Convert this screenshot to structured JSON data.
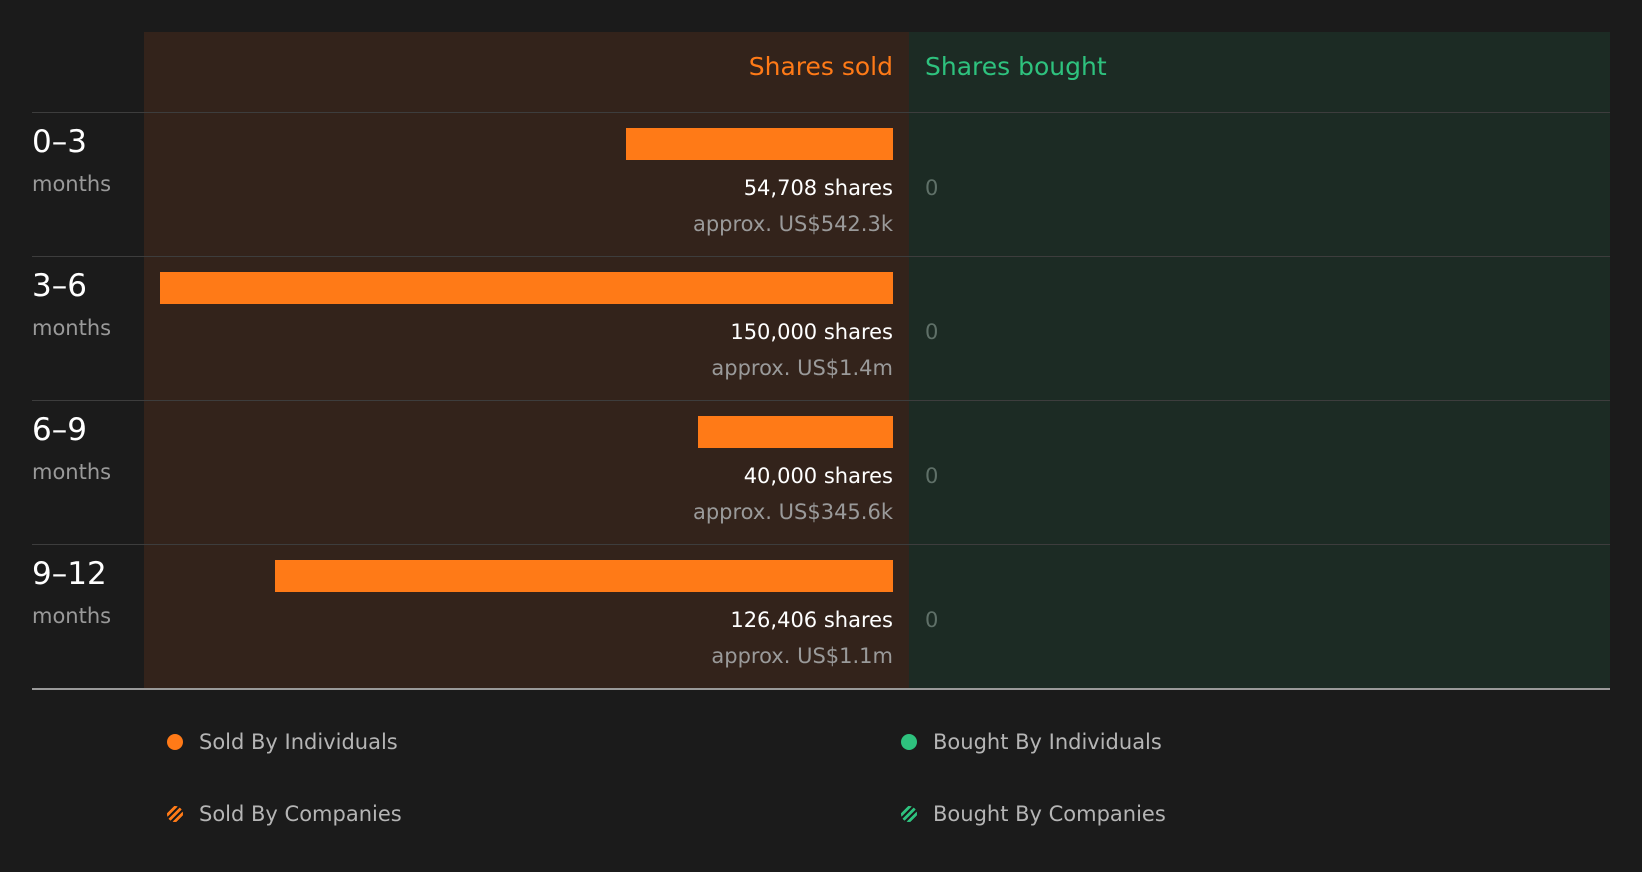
{
  "colors": {
    "sold": "#ff7a17",
    "bought": "#2ec27e"
  },
  "header": {
    "sold_label": "Shares sold",
    "bought_label": "Shares bought"
  },
  "chart_data": {
    "type": "bar",
    "orientation": "horizontal-diverging",
    "categories": [
      "0–3 months",
      "3–6 months",
      "6–9 months",
      "9–12 months"
    ],
    "series": [
      {
        "name": "Shares sold",
        "values": [
          54708,
          150000,
          40000,
          126406
        ]
      },
      {
        "name": "Shares bought",
        "values": [
          0,
          0,
          0,
          0
        ]
      }
    ]
  },
  "rows": [
    {
      "period": "0–3",
      "unit": "months",
      "shares_sold": 54708,
      "sold_label": "54,708 shares",
      "sold_value": "approx. US$542.3k",
      "bought_label": "0"
    },
    {
      "period": "3–6",
      "unit": "months",
      "shares_sold": 150000,
      "sold_label": "150,000 shares",
      "sold_value": "approx. US$1.4m",
      "bought_label": "0"
    },
    {
      "period": "6–9",
      "unit": "months",
      "shares_sold": 40000,
      "sold_label": "40,000 shares",
      "sold_value": "approx. US$345.6k",
      "bought_label": "0"
    },
    {
      "period": "9–12",
      "unit": "months",
      "shares_sold": 126406,
      "sold_label": "126,406 shares",
      "sold_value": "approx. US$1.1m",
      "bought_label": "0"
    }
  ],
  "legend": [
    {
      "label": "Sold By Individuals",
      "color": "#ff7a17",
      "pattern": "solid"
    },
    {
      "label": "Bought By Individuals",
      "color": "#2ec27e",
      "pattern": "solid"
    },
    {
      "label": "Sold By Companies",
      "color": "#ff7a17",
      "pattern": "striped"
    },
    {
      "label": "Bought By Companies",
      "color": "#2ec27e",
      "pattern": "striped"
    }
  ]
}
